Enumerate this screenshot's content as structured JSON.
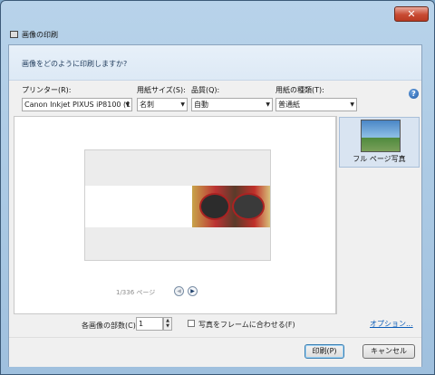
{
  "window": {
    "title": "画像の印刷",
    "close_glyph": "✕"
  },
  "header": {
    "question": "画像をどのように印刷しますか?"
  },
  "printer": {
    "label": "プリンター(R):",
    "value": "Canon Inkjet PIXUS iP8100 (1"
  },
  "paper_size": {
    "label": "用紙サイズ(S):",
    "value": "名刺"
  },
  "quality": {
    "label": "品質(Q):",
    "value": "自動"
  },
  "paper_type": {
    "label": "用紙の種類(T):",
    "value": "普通紙"
  },
  "help": {
    "glyph": "?"
  },
  "preview": {
    "page_text": "1/336 ページ",
    "prev_glyph": "◀",
    "next_glyph": "▶"
  },
  "layouts": [
    {
      "label": "フル ページ写真"
    }
  ],
  "copies": {
    "label": "各画像の部数(C):",
    "value": "1"
  },
  "fit_frame": {
    "label": "写真をフレームに合わせる(F)",
    "checked": false
  },
  "options_link": "オプション...",
  "buttons": {
    "print": "印刷(P)",
    "cancel": "キャンセル"
  },
  "colors": {
    "accent": "#0a5cb8",
    "selection": "#d9e4f1"
  },
  "icons": [
    "close-icon",
    "printer-window-icon",
    "help-icon",
    "prev-page-icon",
    "next-page-icon",
    "spinner-up-icon",
    "spinner-down-icon"
  ]
}
